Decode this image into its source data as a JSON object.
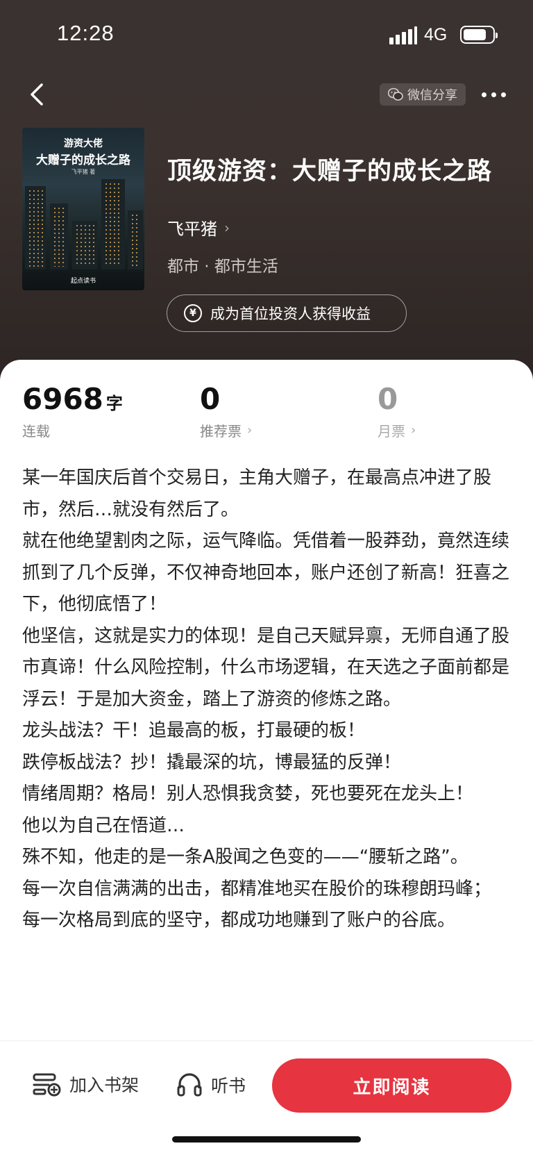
{
  "status_bar": {
    "time": "12:28",
    "network": "4G"
  },
  "header": {
    "share_label": "微信分享"
  },
  "book": {
    "cover": {
      "line1": "游资大佬",
      "line2": "大赠子的成长之路",
      "author_small": "飞平猪 著",
      "brand": "起点读书"
    },
    "title": "顶级游资：大赠子的成长之路",
    "author": "飞平猪",
    "genre": "都市 · 都市生活",
    "invest_label": "成为首位投资人获得收益"
  },
  "stats": {
    "words": {
      "value": "6968",
      "unit": "字",
      "label": "连载"
    },
    "recommend": {
      "value": "0",
      "label": "推荐票"
    },
    "monthly": {
      "value": "0",
      "label": "月票"
    }
  },
  "intro_lines": [
    "某一年国庆后首个交易日，主角大赠子，在最高点冲进了股市，然后…就没有然后了。",
    "就在他绝望割肉之际，运气降临。凭借着一股莽劲，竟然连续抓到了几个反弹，不仅神奇地回本，账户还创了新高！狂喜之下，他彻底悟了！",
    "他坚信，这就是实力的体现！是自己天赋异禀，无师自通了股市真谛！什么风险控制，什么市场逻辑，在天选之子面前都是浮云！于是加大资金，踏上了游资的修炼之路。",
    "龙头战法？干！追最高的板，打最硬的板！",
    "跌停板战法？抄！撬最深的坑，博最猛的反弹！",
    "情绪周期？格局！别人恐惧我贪婪，死也要死在龙头上！",
    "他以为自己在悟道…",
    "殊不知，他走的是一条A股闻之色变的——“腰斩之路”。",
    "每一次自信满满的出击，都精准地买在股价的珠穆朗玛峰；",
    "每一次格局到底的坚守，都成功地赚到了账户的谷底。"
  ],
  "bottom": {
    "add_shelf": "加入书架",
    "listen": "听书",
    "read_now": "立即阅读"
  },
  "colors": {
    "accent": "#e63440",
    "hero_bg": "#3a3230"
  }
}
